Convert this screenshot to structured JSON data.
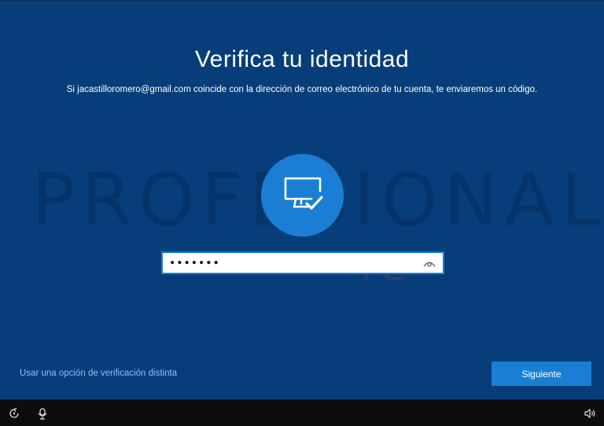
{
  "screen": {
    "title": "Verifica tu identidad",
    "subtitle": "Si jacastilloromero@gmail.com coincide con la dirección de correo electrónico de tu cuenta, te enviaremos un código.",
    "avatar_icon": "monitor-check-icon"
  },
  "watermark": {
    "text": "PROFESIONAL",
    "mark": "re"
  },
  "code_field": {
    "value": "•••••••",
    "reveal_icon": "eye-icon"
  },
  "links": {
    "alternate_verification": "Usar una opción de verificación distinta"
  },
  "buttons": {
    "next": "Siguiente"
  },
  "taskbar": {
    "left_icons": [
      "ease-of-access-icon",
      "microphone-icon"
    ],
    "right_icons": [
      "volume-icon"
    ]
  },
  "colors": {
    "background": "#073e7a",
    "accent": "#1a7fd4",
    "link": "#7dc4ff",
    "taskbar": "#0d0d0d"
  }
}
